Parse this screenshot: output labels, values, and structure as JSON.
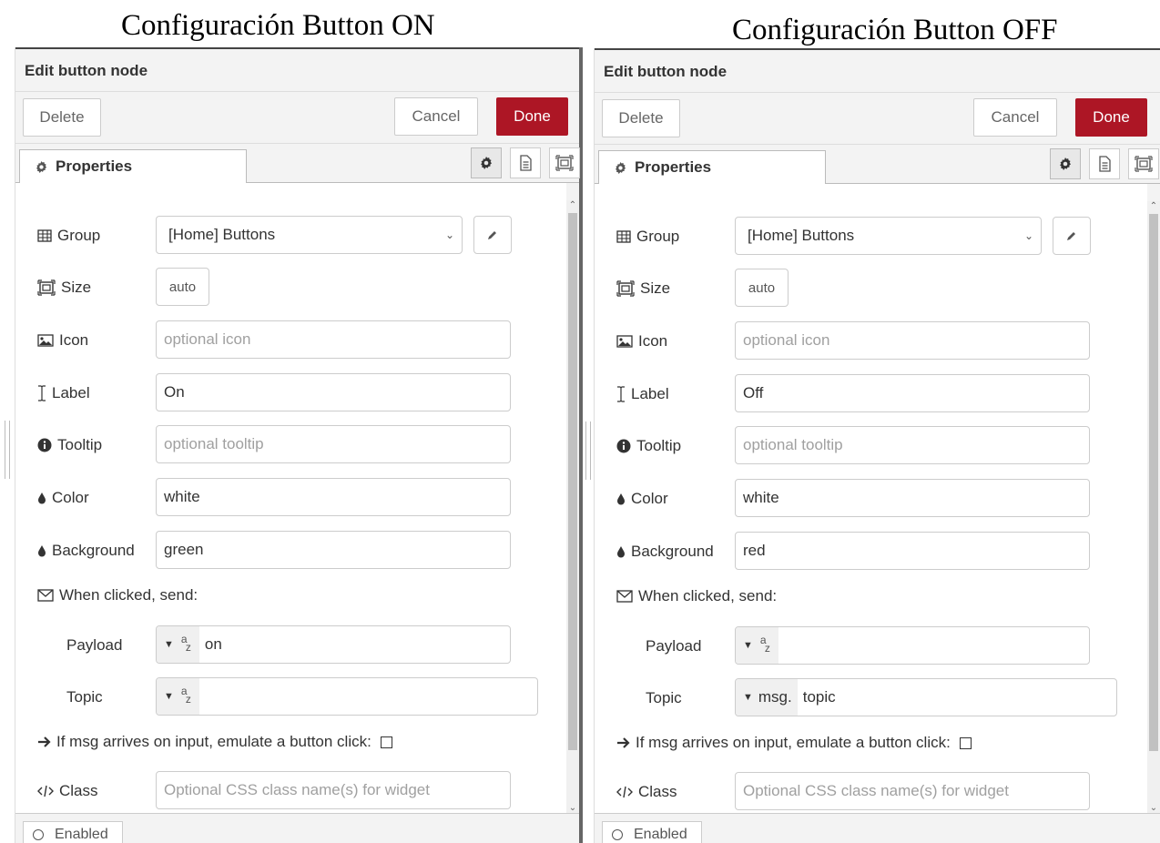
{
  "captions": {
    "left": "Configuración Button ON",
    "right": "Configuración Button OFF"
  },
  "panels": [
    {
      "title": "Edit button node",
      "delete_label": "Delete",
      "cancel_label": "Cancel",
      "done_label": "Done",
      "tab_label": "Properties",
      "group_label": "Group",
      "group_value": "[Home] Buttons",
      "size_label": "Size",
      "size_value": "auto",
      "icon_label": "Icon",
      "icon_placeholder": "optional icon",
      "label_label": "Label",
      "label_value": "On",
      "tooltip_label": "Tooltip",
      "tooltip_placeholder": "optional tooltip",
      "color_label": "Color",
      "color_value": "white",
      "background_label": "Background",
      "background_value": "green",
      "when_clicked_label": "When clicked, send:",
      "payload_label": "Payload",
      "payload_value": "on",
      "topic_label": "Topic",
      "topic_type": "",
      "topic_value": "",
      "emulate_label": "If msg arrives on input, emulate a button click:",
      "class_label": "Class",
      "class_placeholder": "Optional CSS class name(s) for widget",
      "enabled_label": "Enabled"
    },
    {
      "title": "Edit button node",
      "delete_label": "Delete",
      "cancel_label": "Cancel",
      "done_label": "Done",
      "tab_label": "Properties",
      "group_label": "Group",
      "group_value": "[Home] Buttons",
      "size_label": "Size",
      "size_value": "auto",
      "icon_label": "Icon",
      "icon_placeholder": "optional icon",
      "label_label": "Label",
      "label_value": "Off",
      "tooltip_label": "Tooltip",
      "tooltip_placeholder": "optional tooltip",
      "color_label": "Color",
      "color_value": "white",
      "background_label": "Background",
      "background_value": "red",
      "when_clicked_label": "When clicked, send:",
      "payload_label": "Payload",
      "payload_value": "",
      "topic_label": "Topic",
      "topic_type": "msg.",
      "topic_value": "topic",
      "emulate_label": "If msg arrives on input, emulate a button click:",
      "class_label": "Class",
      "class_placeholder": "Optional CSS class name(s) for widget",
      "enabled_label": "Enabled"
    }
  ],
  "colors": {
    "done": "#ad1625",
    "tray": "#f3f3f3"
  },
  "icons": [
    "cog-icon",
    "file-text-icon",
    "window-frame-icon",
    "table-icon",
    "resize-icon",
    "image-icon",
    "i-cursor-icon",
    "info-circle-icon",
    "tint-icon",
    "envelope-icon",
    "arrow-right-icon",
    "code-icon",
    "pencil-icon"
  ]
}
